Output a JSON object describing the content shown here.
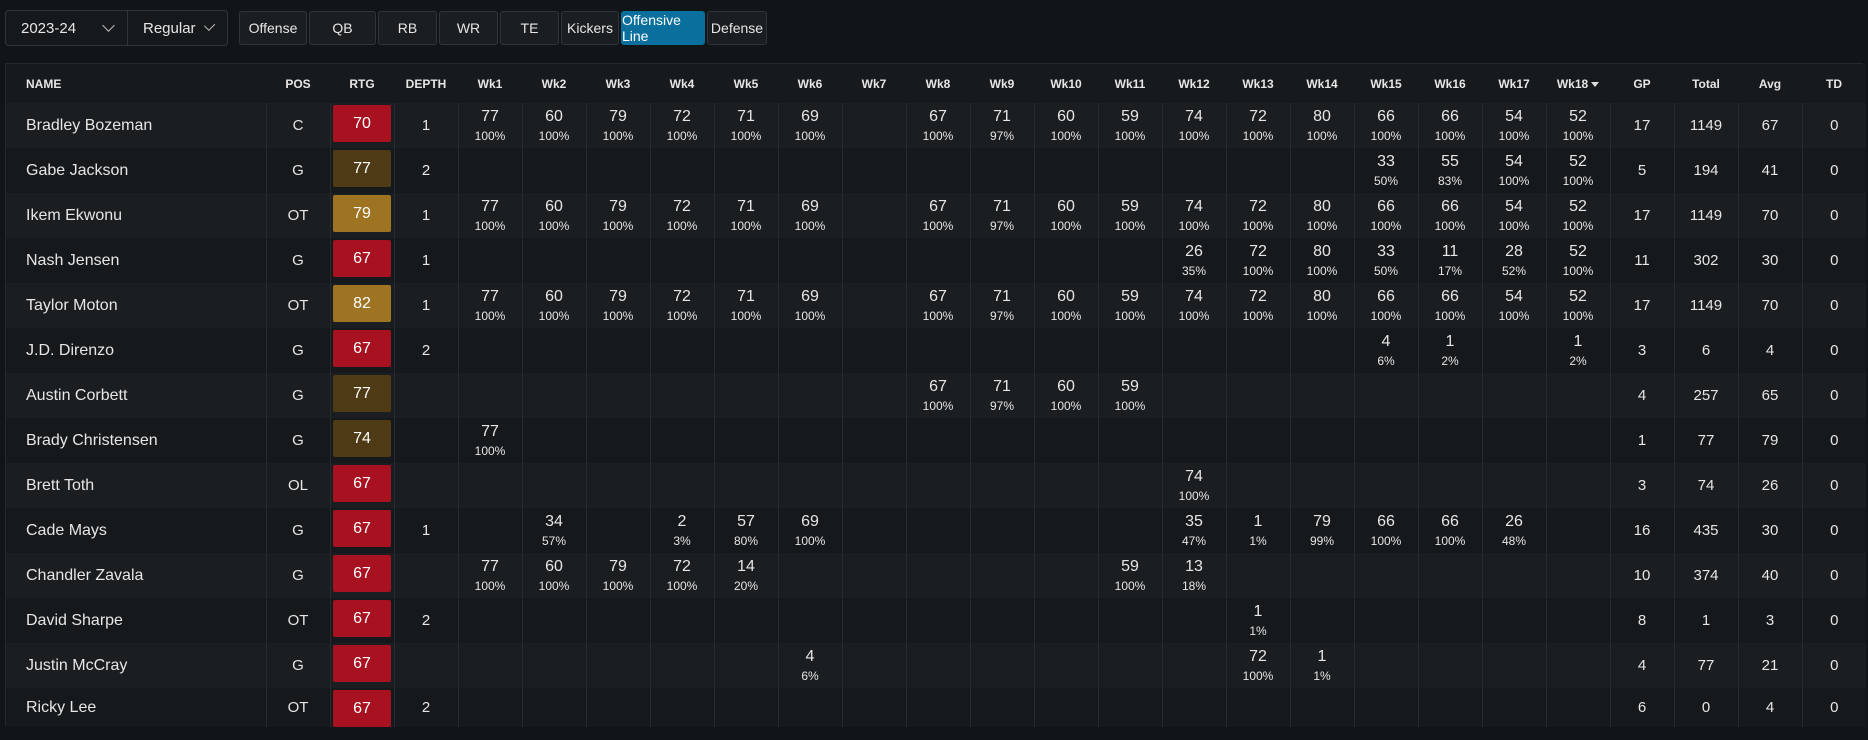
{
  "filters": {
    "season": "2023-24",
    "season_type": "Regular"
  },
  "tabs": [
    {
      "label": "Offense",
      "active": false
    },
    {
      "label": "QB",
      "active": false
    },
    {
      "label": "RB",
      "active": false
    },
    {
      "label": "WR",
      "active": false
    },
    {
      "label": "TE",
      "active": false
    },
    {
      "label": "Kickers",
      "active": false
    },
    {
      "label": "Offensive Line",
      "active": true
    },
    {
      "label": "Defense",
      "active": false
    }
  ],
  "columns": [
    "NAME",
    "POS",
    "RTG",
    "DEPTH",
    "Wk1",
    "Wk2",
    "Wk3",
    "Wk4",
    "Wk5",
    "Wk6",
    "Wk7",
    "Wk8",
    "Wk9",
    "Wk10",
    "Wk11",
    "Wk12",
    "Wk13",
    "Wk14",
    "Wk15",
    "Wk16",
    "Wk17",
    "Wk18",
    "GP",
    "Total",
    "Avg",
    "TD"
  ],
  "sorted_column": "Wk18",
  "colors": {
    "rtg_red": "#a8111f",
    "rtg_dark_gold": "#4e3a14",
    "rtg_gold": "#9e7322",
    "active_tab": "#0a6f9c"
  },
  "rows": [
    {
      "name": "Bradley Bozeman",
      "pos": "C",
      "rtg": "70",
      "rtg_color": "red",
      "depth": "1",
      "weeks": [
        [
          "77",
          "100%"
        ],
        [
          "60",
          "100%"
        ],
        [
          "79",
          "100%"
        ],
        [
          "72",
          "100%"
        ],
        [
          "71",
          "100%"
        ],
        [
          "69",
          "100%"
        ],
        null,
        [
          "67",
          "100%"
        ],
        [
          "71",
          "97%"
        ],
        [
          "60",
          "100%"
        ],
        [
          "59",
          "100%"
        ],
        [
          "74",
          "100%"
        ],
        [
          "72",
          "100%"
        ],
        [
          "80",
          "100%"
        ],
        [
          "66",
          "100%"
        ],
        [
          "66",
          "100%"
        ],
        [
          "54",
          "100%"
        ],
        [
          "52",
          "100%"
        ]
      ],
      "gp": "17",
      "total": "1149",
      "avg": "67",
      "td": "0"
    },
    {
      "name": "Gabe Jackson",
      "pos": "G",
      "rtg": "77",
      "rtg_color": "dark",
      "depth": "2",
      "weeks": [
        null,
        null,
        null,
        null,
        null,
        null,
        null,
        null,
        null,
        null,
        null,
        null,
        null,
        null,
        [
          "33",
          "50%"
        ],
        [
          "55",
          "83%"
        ],
        [
          "54",
          "100%"
        ],
        [
          "52",
          "100%"
        ]
      ],
      "gp": "5",
      "total": "194",
      "avg": "41",
      "td": "0"
    },
    {
      "name": "Ikem Ekwonu",
      "pos": "OT",
      "rtg": "79",
      "rtg_color": "gold",
      "depth": "1",
      "weeks": [
        [
          "77",
          "100%"
        ],
        [
          "60",
          "100%"
        ],
        [
          "79",
          "100%"
        ],
        [
          "72",
          "100%"
        ],
        [
          "71",
          "100%"
        ],
        [
          "69",
          "100%"
        ],
        null,
        [
          "67",
          "100%"
        ],
        [
          "71",
          "97%"
        ],
        [
          "60",
          "100%"
        ],
        [
          "59",
          "100%"
        ],
        [
          "74",
          "100%"
        ],
        [
          "72",
          "100%"
        ],
        [
          "80",
          "100%"
        ],
        [
          "66",
          "100%"
        ],
        [
          "66",
          "100%"
        ],
        [
          "54",
          "100%"
        ],
        [
          "52",
          "100%"
        ]
      ],
      "gp": "17",
      "total": "1149",
      "avg": "70",
      "td": "0"
    },
    {
      "name": "Nash Jensen",
      "pos": "G",
      "rtg": "67",
      "rtg_color": "red",
      "depth": "1",
      "weeks": [
        null,
        null,
        null,
        null,
        null,
        null,
        null,
        null,
        null,
        null,
        null,
        [
          "26",
          "35%"
        ],
        [
          "72",
          "100%"
        ],
        [
          "80",
          "100%"
        ],
        [
          "33",
          "50%"
        ],
        [
          "11",
          "17%"
        ],
        [
          "28",
          "52%"
        ],
        [
          "52",
          "100%"
        ]
      ],
      "gp": "11",
      "total": "302",
      "avg": "30",
      "td": "0"
    },
    {
      "name": "Taylor Moton",
      "pos": "OT",
      "rtg": "82",
      "rtg_color": "gold",
      "depth": "1",
      "weeks": [
        [
          "77",
          "100%"
        ],
        [
          "60",
          "100%"
        ],
        [
          "79",
          "100%"
        ],
        [
          "72",
          "100%"
        ],
        [
          "71",
          "100%"
        ],
        [
          "69",
          "100%"
        ],
        null,
        [
          "67",
          "100%"
        ],
        [
          "71",
          "97%"
        ],
        [
          "60",
          "100%"
        ],
        [
          "59",
          "100%"
        ],
        [
          "74",
          "100%"
        ],
        [
          "72",
          "100%"
        ],
        [
          "80",
          "100%"
        ],
        [
          "66",
          "100%"
        ],
        [
          "66",
          "100%"
        ],
        [
          "54",
          "100%"
        ],
        [
          "52",
          "100%"
        ]
      ],
      "gp": "17",
      "total": "1149",
      "avg": "70",
      "td": "0"
    },
    {
      "name": "J.D. Direnzo",
      "pos": "G",
      "rtg": "67",
      "rtg_color": "red",
      "depth": "2",
      "weeks": [
        null,
        null,
        null,
        null,
        null,
        null,
        null,
        null,
        null,
        null,
        null,
        null,
        null,
        null,
        [
          "4",
          "6%"
        ],
        [
          "1",
          "2%"
        ],
        null,
        [
          "1",
          "2%"
        ]
      ],
      "gp": "3",
      "total": "6",
      "avg": "4",
      "td": "0"
    },
    {
      "name": "Austin Corbett",
      "pos": "G",
      "rtg": "77",
      "rtg_color": "dark",
      "depth": "",
      "weeks": [
        null,
        null,
        null,
        null,
        null,
        null,
        null,
        [
          "67",
          "100%"
        ],
        [
          "71",
          "97%"
        ],
        [
          "60",
          "100%"
        ],
        [
          "59",
          "100%"
        ],
        null,
        null,
        null,
        null,
        null,
        null,
        null
      ],
      "gp": "4",
      "total": "257",
      "avg": "65",
      "td": "0"
    },
    {
      "name": "Brady Christensen",
      "pos": "G",
      "rtg": "74",
      "rtg_color": "dark",
      "depth": "",
      "weeks": [
        [
          "77",
          "100%"
        ],
        null,
        null,
        null,
        null,
        null,
        null,
        null,
        null,
        null,
        null,
        null,
        null,
        null,
        null,
        null,
        null,
        null
      ],
      "gp": "1",
      "total": "77",
      "avg": "79",
      "td": "0"
    },
    {
      "name": "Brett Toth",
      "pos": "OL",
      "rtg": "67",
      "rtg_color": "red",
      "depth": "",
      "weeks": [
        null,
        null,
        null,
        null,
        null,
        null,
        null,
        null,
        null,
        null,
        null,
        [
          "74",
          "100%"
        ],
        null,
        null,
        null,
        null,
        null,
        null
      ],
      "gp": "3",
      "total": "74",
      "avg": "26",
      "td": "0"
    },
    {
      "name": "Cade Mays",
      "pos": "G",
      "rtg": "67",
      "rtg_color": "red",
      "depth": "1",
      "weeks": [
        null,
        [
          "34",
          "57%"
        ],
        null,
        [
          "2",
          "3%"
        ],
        [
          "57",
          "80%"
        ],
        [
          "69",
          "100%"
        ],
        null,
        null,
        null,
        null,
        null,
        [
          "35",
          "47%"
        ],
        [
          "1",
          "1%"
        ],
        [
          "79",
          "99%"
        ],
        [
          "66",
          "100%"
        ],
        [
          "66",
          "100%"
        ],
        [
          "26",
          "48%"
        ],
        null
      ],
      "gp": "16",
      "total": "435",
      "avg": "30",
      "td": "0"
    },
    {
      "name": "Chandler Zavala",
      "pos": "G",
      "rtg": "67",
      "rtg_color": "red",
      "depth": "",
      "weeks": [
        [
          "77",
          "100%"
        ],
        [
          "60",
          "100%"
        ],
        [
          "79",
          "100%"
        ],
        [
          "72",
          "100%"
        ],
        [
          "14",
          "20%"
        ],
        null,
        null,
        null,
        null,
        null,
        [
          "59",
          "100%"
        ],
        [
          "13",
          "18%"
        ],
        null,
        null,
        null,
        null,
        null,
        null
      ],
      "gp": "10",
      "total": "374",
      "avg": "40",
      "td": "0"
    },
    {
      "name": "David Sharpe",
      "pos": "OT",
      "rtg": "67",
      "rtg_color": "red",
      "depth": "2",
      "weeks": [
        null,
        null,
        null,
        null,
        null,
        null,
        null,
        null,
        null,
        null,
        null,
        null,
        [
          "1",
          "1%"
        ],
        null,
        null,
        null,
        null,
        null
      ],
      "gp": "8",
      "total": "1",
      "avg": "3",
      "td": "0"
    },
    {
      "name": "Justin McCray",
      "pos": "G",
      "rtg": "67",
      "rtg_color": "red",
      "depth": "",
      "weeks": [
        null,
        null,
        null,
        null,
        null,
        [
          "4",
          "6%"
        ],
        null,
        null,
        null,
        null,
        null,
        null,
        [
          "72",
          "100%"
        ],
        [
          "1",
          "1%"
        ],
        null,
        null,
        null,
        null
      ],
      "gp": "4",
      "total": "77",
      "avg": "21",
      "td": "0"
    },
    {
      "name": "Ricky Lee",
      "pos": "OT",
      "rtg": "67",
      "rtg_color": "red",
      "depth": "2",
      "weeks": [
        null,
        null,
        null,
        null,
        null,
        null,
        null,
        null,
        null,
        null,
        null,
        null,
        null,
        null,
        null,
        null,
        null,
        null
      ],
      "gp": "6",
      "total": "0",
      "avg": "4",
      "td": "0"
    }
  ]
}
